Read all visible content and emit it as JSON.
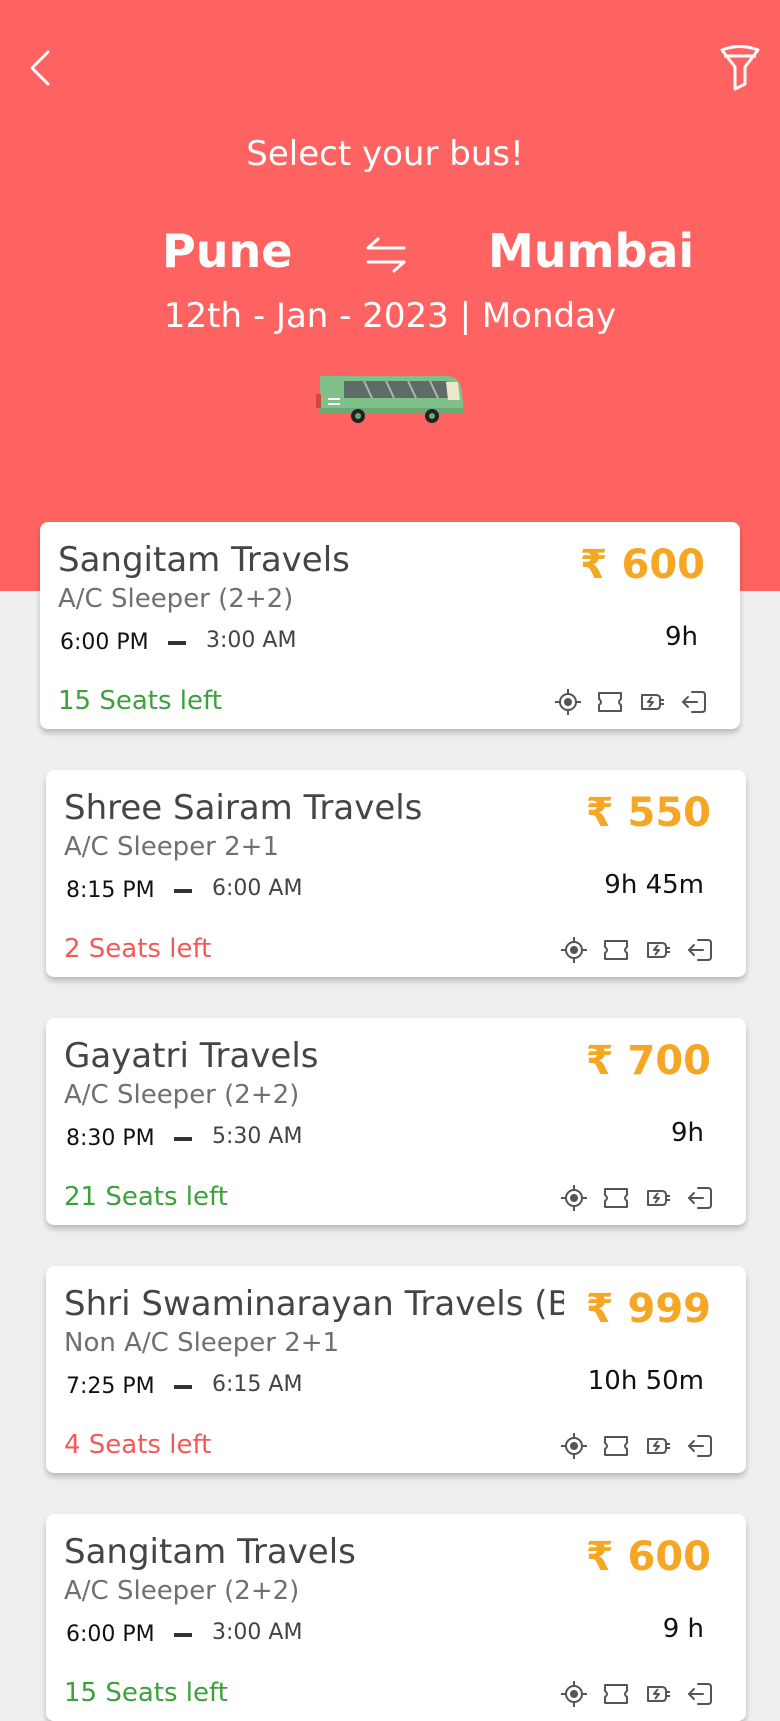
{
  "header": {
    "title": "Select your bus!",
    "from": "Pune",
    "to": "Mumbai",
    "date": "12th - Jan - 2023 | Monday"
  },
  "colors": {
    "header_bg": "#ff6361",
    "price": "#f5a623",
    "seats_available": "#3da03d",
    "seats_low": "#f25a57"
  },
  "icons": {
    "back": "chevron-left-icon",
    "filter": "filter-icon",
    "swap": "swap-arrows-icon",
    "bus": "bus-illustration",
    "amenities": [
      "gps-tracking-icon",
      "ticket-icon",
      "charging-icon",
      "exit-icon"
    ]
  },
  "buses": [
    {
      "name": "Sangitam Travels",
      "type": "A/C Sleeper (2+2)",
      "departure": "6:00 PM",
      "arrival": "3:00 AM",
      "price": "₹ 600",
      "duration": "9h",
      "seats": "15 Seats  left",
      "seat_status": "available"
    },
    {
      "name": "Shree Sairam Travels",
      "type": "A/C Sleeper 2+1",
      "departure": "8:15 PM",
      "arrival": "6:00 AM",
      "price": "₹ 550",
      "duration": "9h 45m",
      "seats": "2 Seats  left",
      "seat_status": "low"
    },
    {
      "name": "Gayatri Travels",
      "type": "A/C Sleeper (2+2)",
      "departure": "8:30 PM",
      "arrival": "5:30 AM",
      "price": "₹ 700",
      "duration": "9h",
      "seats": "21 Seats  left",
      "seat_status": "available"
    },
    {
      "name": "Shri Swaminarayan Travels (Bh..",
      "type": "Non A/C Sleeper 2+1",
      "departure": "7:25 PM",
      "arrival": "6:15 AM",
      "price": "₹ 999",
      "duration": "10h 50m",
      "seats": "4 Seats  left",
      "seat_status": "low"
    },
    {
      "name": "Sangitam Travels",
      "type": "A/C Sleeper (2+2)",
      "departure": "6:00 PM",
      "arrival": "3:00 AM",
      "price": "₹ 600",
      "duration": "9 h",
      "seats": "15 Seats  left",
      "seat_status": "available"
    }
  ]
}
